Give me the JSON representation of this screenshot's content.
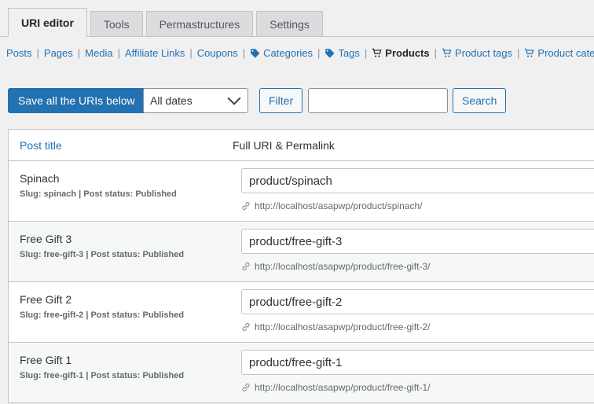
{
  "tabs": [
    {
      "label": "URI editor",
      "active": true
    },
    {
      "label": "Tools",
      "active": false
    },
    {
      "label": "Permastructures",
      "active": false
    },
    {
      "label": "Settings",
      "active": false
    }
  ],
  "subnav": [
    {
      "label": "Posts",
      "icon": null,
      "current": false
    },
    {
      "label": "Pages",
      "icon": null,
      "current": false
    },
    {
      "label": "Media",
      "icon": null,
      "current": false
    },
    {
      "label": "Affiliate Links",
      "icon": null,
      "current": false
    },
    {
      "label": "Coupons",
      "icon": null,
      "current": false
    },
    {
      "label": "Categories",
      "icon": "tag-icon",
      "current": false
    },
    {
      "label": "Tags",
      "icon": "tag-icon",
      "current": false
    },
    {
      "label": "Products",
      "icon": "cart-icon",
      "current": true
    },
    {
      "label": "Product tags",
      "icon": "cart-icon",
      "current": false
    },
    {
      "label": "Product categories",
      "icon": "cart-icon",
      "current": false
    }
  ],
  "toolbar": {
    "save_label": "Save all the URIs below",
    "date_filter_value": "All dates",
    "date_filter_options": [
      "All dates"
    ],
    "filter_label": "Filter",
    "search_value": "",
    "search_placeholder": "",
    "search_label": "Search"
  },
  "table": {
    "columns": {
      "post_title": "Post title",
      "full_uri": "Full URI & Permalink"
    },
    "rows": [
      {
        "title": "Spinach",
        "meta": "Slug: spinach | Post status: Published",
        "uri": "product/spinach",
        "permalink": "http://localhost/asapwp/product/spinach/"
      },
      {
        "title": "Free Gift 3",
        "meta": "Slug: free-gift-3 | Post status: Published",
        "uri": "product/free-gift-3",
        "permalink": "http://localhost/asapwp/product/free-gift-3/"
      },
      {
        "title": "Free Gift 2",
        "meta": "Slug: free-gift-2 | Post status: Published",
        "uri": "product/free-gift-2",
        "permalink": "http://localhost/asapwp/product/free-gift-2/"
      },
      {
        "title": "Free Gift 1",
        "meta": "Slug: free-gift-1 | Post status: Published",
        "uri": "product/free-gift-1",
        "permalink": "http://localhost/asapwp/product/free-gift-1/"
      }
    ]
  },
  "colors": {
    "accent": "#2271b1",
    "page_bg": "#f0f0f1",
    "border": "#c3c4c7",
    "text": "#2c3338",
    "muted": "#646970"
  }
}
